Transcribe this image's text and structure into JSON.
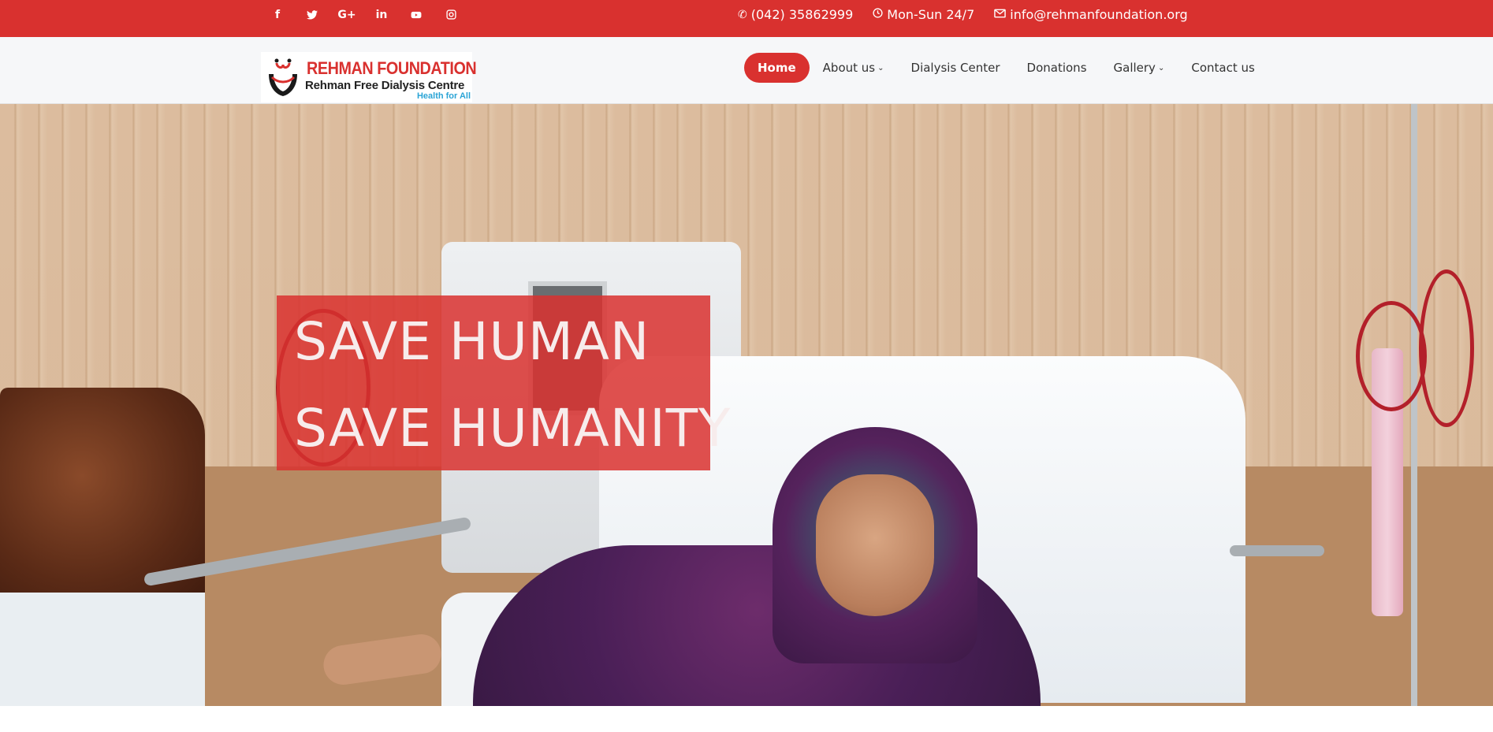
{
  "topbar": {
    "social": [
      {
        "icon": "facebook-icon",
        "glyph": "f"
      },
      {
        "icon": "twitter-icon",
        "glyph": "🐦"
      },
      {
        "icon": "google-plus-icon",
        "glyph": "G+"
      },
      {
        "icon": "linkedin-icon",
        "glyph": "in"
      },
      {
        "icon": "youtube-icon",
        "glyph": "▶"
      },
      {
        "icon": "instagram-icon",
        "glyph": "◎"
      }
    ],
    "phone": "(042) 35862999",
    "hours": "Mon-Sun 24/7",
    "email": "info@rehmanfoundation.org"
  },
  "logo": {
    "title": "REHMAN FOUNDATION",
    "subtitle": "Rehman Free Dialysis Centre",
    "tagline": "Health for All"
  },
  "nav": {
    "home": "Home",
    "about": "About us",
    "dialysis": "Dialysis Center",
    "donations": "Donations",
    "gallery": "Gallery",
    "contact": "Contact us"
  },
  "hero": {
    "line1": "SAVE HUMAN",
    "line2": "SAVE HUMANITY"
  },
  "colors": {
    "brand_red": "#d9312f",
    "tagline_blue": "#2aa4d6"
  }
}
